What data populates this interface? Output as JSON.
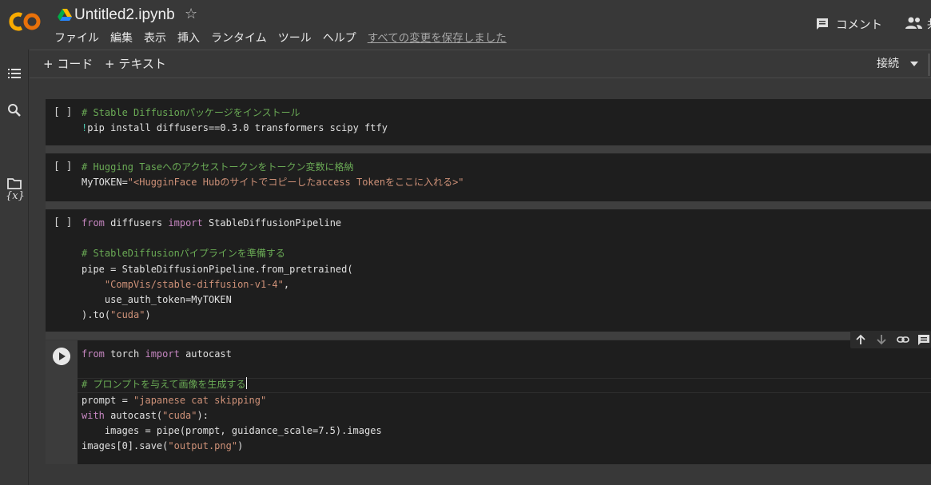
{
  "app": {
    "logo_text": "CO",
    "title": "Untitled2.ipynb"
  },
  "menu": {
    "items": [
      "ファイル",
      "編集",
      "表示",
      "挿入",
      "ランタイム",
      "ツール",
      "ヘルプ"
    ],
    "save_status": "すべての変更を保存しました"
  },
  "header_right": {
    "comment_label": "コメント",
    "share_label": "共"
  },
  "toolbar": {
    "add_code": "+ コード",
    "add_text": "+ テキスト",
    "connect": "接続"
  },
  "cells": [
    {
      "prompt": "[ ]",
      "lines": [
        [
          {
            "t": "# Stable Diffusionパッケージをインストール",
            "c": "comment"
          }
        ],
        [
          {
            "t": "!",
            "c": "bang"
          },
          {
            "t": "pip install diffusers==0.3.0 transformers scipy ftfy",
            "c": ""
          }
        ]
      ]
    },
    {
      "prompt": "[ ]",
      "lines": [
        [
          {
            "t": "# Hugging Taseへのアクセストークンをトークン変数に格納",
            "c": "comment"
          }
        ],
        [
          {
            "t": "MyTOKEN=",
            "c": ""
          },
          {
            "t": "\"<HugginFace Hubのサイトでコピーしたaccess Tokenをここに入れる>\"",
            "c": "str"
          }
        ]
      ]
    },
    {
      "prompt": "[ ]",
      "lines": [
        [
          {
            "t": "from",
            "c": "kw"
          },
          {
            "t": " diffusers ",
            "c": ""
          },
          {
            "t": "import",
            "c": "kw"
          },
          {
            "t": " StableDiffusionPipeline",
            "c": ""
          }
        ],
        [],
        [
          {
            "t": "# StableDiffusionパイプラインを準備する",
            "c": "comment"
          }
        ],
        [
          {
            "t": "pipe = StableDiffusionPipeline.from_pretrained(",
            "c": ""
          }
        ],
        [
          {
            "t": "    ",
            "c": ""
          },
          {
            "t": "\"CompVis/stable-diffusion-v1-4\"",
            "c": "str"
          },
          {
            "t": ",",
            "c": ""
          }
        ],
        [
          {
            "t": "    use_auth_token=MyTOKEN",
            "c": ""
          }
        ],
        [
          {
            "t": ").to(",
            "c": ""
          },
          {
            "t": "\"cuda\"",
            "c": "str"
          },
          {
            "t": ")",
            "c": ""
          }
        ]
      ]
    },
    {
      "prompt": "",
      "lines": [
        [
          {
            "t": "from",
            "c": "kw"
          },
          {
            "t": " torch ",
            "c": ""
          },
          {
            "t": "import",
            "c": "kw"
          },
          {
            "t": " autocast",
            "c": ""
          }
        ],
        [],
        [
          {
            "t": "# プロンプトを与えて画像を生成する",
            "c": "comment"
          }
        ],
        [
          {
            "t": "prompt = ",
            "c": ""
          },
          {
            "t": "\"japanese cat skipping\"",
            "c": "str"
          }
        ],
        [
          {
            "t": "with",
            "c": "kw"
          },
          {
            "t": " autocast(",
            "c": ""
          },
          {
            "t": "\"cuda\"",
            "c": "str"
          },
          {
            "t": "):",
            "c": ""
          }
        ],
        [
          {
            "t": "    images = pipe(prompt, guidance_scale=7.5).images",
            "c": ""
          }
        ],
        [
          {
            "t": "images[0].save(",
            "c": ""
          },
          {
            "t": "\"output.png\"",
            "c": "str"
          },
          {
            "t": ")",
            "c": ""
          }
        ]
      ]
    }
  ]
}
